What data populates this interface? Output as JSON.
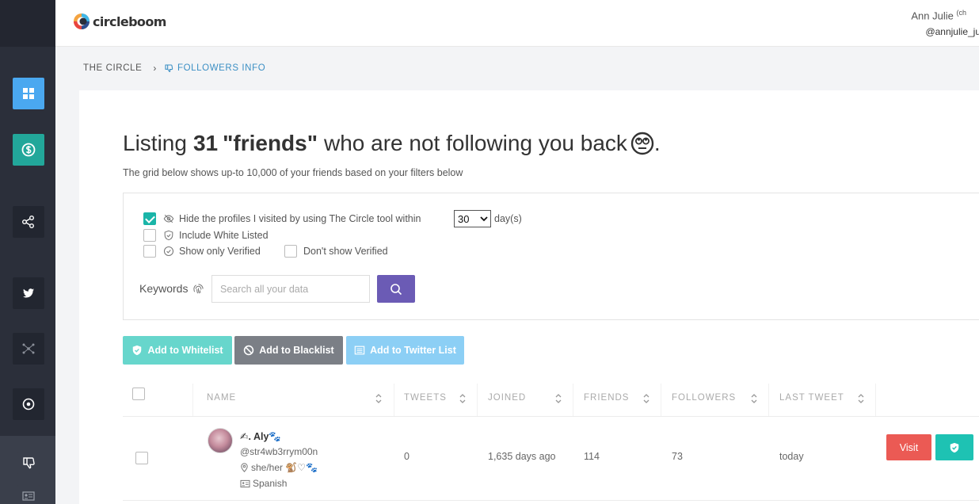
{
  "app": {
    "brand": "circleboom"
  },
  "user": {
    "name": "Ann Julie",
    "name_suffix": "(ch",
    "handle": "@annjulie_ju"
  },
  "breadcrumb": {
    "home": "THE CIRCLE",
    "separator": "›",
    "current": "FOLLOWERS INFO"
  },
  "headline": {
    "prefix": "Listing",
    "count": "31",
    "keyword": "\"friends\"",
    "suffix": "who are not following you back",
    "end": "."
  },
  "subtext": "The grid below shows up-to 10,000 of your friends based on your filters below",
  "filters": {
    "hide_visited": {
      "label": "Hide the profiles I visited by using The Circle tool within",
      "checked": true
    },
    "days_value": "30",
    "days_unit": "day(s)",
    "include_whitelisted": {
      "label": "Include White Listed",
      "checked": false
    },
    "only_verified": {
      "label": "Show only Verified",
      "checked": false
    },
    "dont_show_verified": {
      "label": "Don't show Verified",
      "checked": false
    },
    "keywords_label": "Keywords",
    "search_placeholder": "Search all your data"
  },
  "actions": {
    "whitelist": "Add to Whitelist",
    "blacklist": "Add to Blacklist",
    "twitter_list": "Add to Twitter List"
  },
  "table": {
    "columns": [
      "NAME",
      "TWEETS",
      "JOINED",
      "FRIENDS",
      "FOLLOWERS",
      "LAST TWEET"
    ],
    "rows": [
      {
        "name": "✍︎. Aly🐾",
        "handle": "@str4wb3rrym00n",
        "pronouns": "she/her 🐒♡🐾",
        "language": "Spanish",
        "tweets": "0",
        "joined": "1,635 days ago",
        "friends": "114",
        "followers": "73",
        "last_tweet": "today",
        "visit_label": "Visit"
      }
    ]
  },
  "colors": {
    "sidebar": "#2b2f3a",
    "accent_teal": "#1ab5a8",
    "accent_purple": "#6b5bb5",
    "visit_red": "#eb5a54",
    "link_blue": "#3b8fc4"
  }
}
